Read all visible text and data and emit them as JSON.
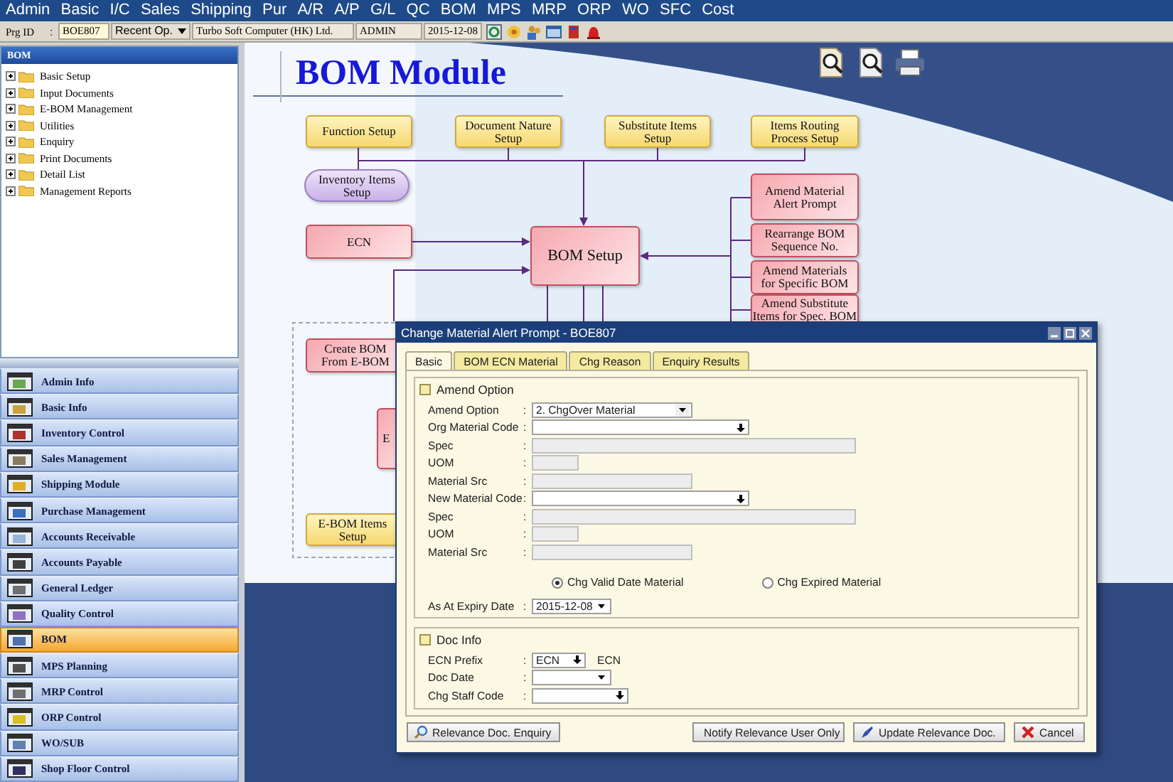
{
  "menu_bar": {
    "items": [
      "Admin",
      "Basic",
      "I/C",
      "Sales",
      "Shipping",
      "Pur",
      "A/R",
      "A/P",
      "G/L",
      "QC",
      "BOM",
      "MPS",
      "MRP",
      "ORP",
      "WO",
      "SFC",
      "Cost"
    ]
  },
  "toolbar": {
    "label": "Prg ID",
    "separator": ":",
    "program_id": "BOE807",
    "recent": "Recent Op.",
    "company": "Turbo Soft Computer (HK) Ltd.",
    "user": "ADMIN",
    "date": "2015-12-08"
  },
  "tree": {
    "title": "BOM",
    "items": [
      {
        "label": "Basic Setup",
        "expanded": false
      },
      {
        "label": "Input Documents",
        "expanded": false
      },
      {
        "label": "E-BOM Management",
        "expanded": false
      },
      {
        "label": "Utilities",
        "expanded": false
      },
      {
        "label": "Enquiry",
        "expanded": false
      },
      {
        "label": "Print Documents",
        "expanded": false
      },
      {
        "label": "Detail List",
        "expanded": false
      },
      {
        "label": "Management Reports",
        "expanded": false
      }
    ]
  },
  "modules": [
    {
      "label": "Admin Info",
      "selected": false
    },
    {
      "label": "Basic Info",
      "selected": false
    },
    {
      "label": "Inventory Control",
      "selected": false
    },
    {
      "label": "Sales Management",
      "selected": false
    },
    {
      "label": "Shipping Module",
      "selected": false
    },
    {
      "label": "Purchase Management",
      "selected": false
    },
    {
      "label": "Accounts Receivable",
      "selected": false
    },
    {
      "label": "Accounts Payable",
      "selected": false
    },
    {
      "label": "General Ledger",
      "selected": false
    },
    {
      "label": "Quality Control",
      "selected": false
    },
    {
      "label": "BOM",
      "selected": true
    },
    {
      "label": "MPS Planning",
      "selected": false
    },
    {
      "label": "MRP Control",
      "selected": false
    },
    {
      "label": "ORP Control",
      "selected": false
    },
    {
      "label": "WO/SUB",
      "selected": false
    },
    {
      "label": "Shop Floor Control",
      "selected": false
    }
  ],
  "canvas": {
    "title": "BOM Module",
    "nodes": [
      {
        "label": "Function Setup",
        "kind": "setup"
      },
      {
        "label": "Document Nature Setup",
        "kind": "setup"
      },
      {
        "label": "Substitute Items Setup",
        "kind": "setup"
      },
      {
        "label": "Items Routing Process Setup",
        "kind": "setup"
      },
      {
        "label": "Inventory Items Setup",
        "kind": "master"
      },
      {
        "label": "ECN",
        "kind": "process"
      },
      {
        "label": "BOM Setup",
        "kind": "main"
      },
      {
        "label": "Amend Material Alert Prompt",
        "kind": "process"
      },
      {
        "label": "Rearrange BOM Sequence No.",
        "kind": "process"
      },
      {
        "label": "Amend Materials for Specific BOM",
        "kind": "process"
      },
      {
        "label": "Amend Substitute Items for Spec. BOM",
        "kind": "process"
      },
      {
        "label": "Create BOM From E-BOM",
        "kind": "process"
      },
      {
        "label": "E",
        "kind": "process"
      },
      {
        "label": "E-BOM Items Setup",
        "kind": "setup"
      }
    ]
  },
  "dialog": {
    "title": "Change Material Alert Prompt - BOE807",
    "tabs": [
      {
        "label": "Basic",
        "selected": true
      },
      {
        "label": "BOM ECN Material",
        "selected": false
      },
      {
        "label": "Chg Reason",
        "selected": false
      },
      {
        "label": "Enquiry Results",
        "selected": false
      }
    ],
    "amend_group": {
      "title": "Amend Option",
      "fields": [
        {
          "label": "Amend Option",
          "separator": ":",
          "kind": "combo",
          "value": "2. ChgOver Material"
        },
        {
          "label": "Org Material Code",
          "separator": ":",
          "kind": "lookup"
        },
        {
          "label": "Spec",
          "separator": ":",
          "kind": "readonly"
        },
        {
          "label": "UOM",
          "separator": ":",
          "kind": "readonly"
        },
        {
          "label": "Material Src",
          "separator": ":",
          "kind": "readonly"
        },
        {
          "label": "New Material Code",
          "separator": ":",
          "kind": "lookup"
        },
        {
          "label": "Spec",
          "separator": ":",
          "kind": "readonly"
        },
        {
          "label": "UOM",
          "separator": ":",
          "kind": "readonly"
        },
        {
          "label": "Material Src",
          "separator": ":",
          "kind": "readonly"
        }
      ],
      "options": [
        {
          "label": "Chg Valid Date Material",
          "selected": true
        },
        {
          "label": "Chg Expired Material",
          "selected": false
        }
      ],
      "expiry": {
        "label": "As At Expiry Date",
        "separator": ":",
        "kind": "combo",
        "value": "2015-12-08"
      }
    },
    "doc_group": {
      "title": "Doc Info",
      "fields": [
        {
          "label": "ECN Prefix",
          "separator": ":",
          "kind": "lookup",
          "value": "ECN",
          "note": "ECN"
        },
        {
          "label": "Doc Date",
          "separator": ":",
          "kind": "combo"
        },
        {
          "label": "Chg Staff Code",
          "separator": ":",
          "kind": "lookup"
        }
      ]
    },
    "buttons": [
      {
        "label": "Relevance Doc. Enquiry",
        "kind": "search"
      },
      {
        "label": "Notify Relevance User Only",
        "kind": "notify"
      },
      {
        "label": "Update Relevance Doc.",
        "kind": "update"
      },
      {
        "label": "Cancel",
        "kind": "cancel"
      }
    ]
  }
}
